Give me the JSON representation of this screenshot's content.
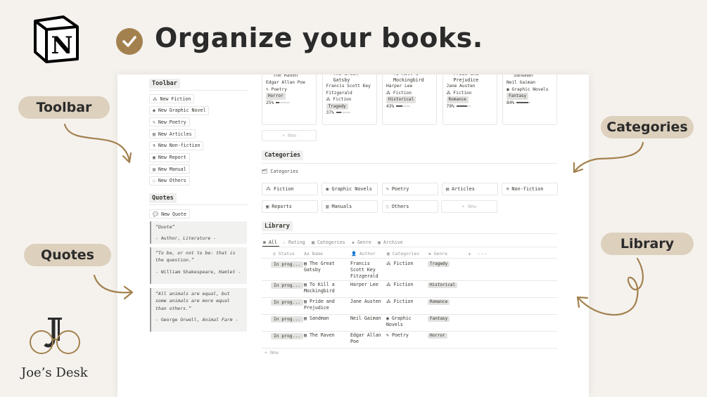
{
  "header": {
    "headline": "Organize your books."
  },
  "callouts": {
    "toolbar": "Toolbar",
    "quotes": "Quotes",
    "categories": "Categories",
    "library": "Library"
  },
  "brand": {
    "name": "Joe’s Desk"
  },
  "colors": {
    "accent": "#a3814e",
    "pill": "#ddd0bd",
    "background": "#f5f2ee"
  },
  "toolbar": {
    "title": "Toolbar",
    "buttons": [
      {
        "icon": "fiction-icon",
        "label": "New Fiction"
      },
      {
        "icon": "graphic-novel-icon",
        "label": "New Graphic Novel"
      },
      {
        "icon": "feather-icon",
        "label": "New Poetry"
      },
      {
        "icon": "articles-icon",
        "label": "New Articles"
      },
      {
        "icon": "flask-icon",
        "label": "New Non-fiction"
      },
      {
        "icon": "report-icon",
        "label": "New Report"
      },
      {
        "icon": "manual-icon",
        "label": "New Manual"
      },
      {
        "icon": "chat-icon",
        "label": "New Others"
      }
    ]
  },
  "quotes": {
    "title": "Quotes",
    "new_label": "New Quote",
    "items": [
      {
        "text": "“Quote”",
        "author": "- Author, ",
        "work": "Literature",
        "end": " -"
      },
      {
        "text": "“To be, or not to be: that is the question.”",
        "author": "- William Shakespeare, ",
        "work": "Hamlet",
        "end": " -"
      },
      {
        "text": "“All animals are equal, but some animals are more equal than others.”",
        "author": "- George Orwell, ",
        "work": "Animal Farm",
        "end": " -"
      }
    ]
  },
  "gallery": {
    "cards": [
      {
        "title": "The Raven",
        "author": "Edgar Allan Poe",
        "category": "Poetry",
        "genre": "Horror",
        "progress": "25%",
        "progress_value": 25
      },
      {
        "title": "The Great Gatsby",
        "author": "Francis Scott Key Fitzgerald",
        "category": "Fiction",
        "genre": "Tragedy",
        "progress": "37%",
        "progress_value": 37
      },
      {
        "title": "To Kill a Mockingbird",
        "author": "Harper Lee",
        "category": "Fiction",
        "genre": "Historical",
        "progress": "43%",
        "progress_value": 43
      },
      {
        "title": "Pride and Prejudice",
        "author": "Jane Austen",
        "category": "Fiction",
        "genre": "Romance",
        "progress": "79%",
        "progress_value": 79
      },
      {
        "title": "Sandman",
        "author": "Neil Gaiman",
        "category": "Graphic Novels",
        "genre": "Fantasy",
        "progress": "84%",
        "progress_value": 84
      }
    ],
    "new_label": "+ New"
  },
  "categories": {
    "title": "Categories",
    "db_label": "Categories",
    "items": [
      {
        "icon": "fiction-icon",
        "label": "Fiction"
      },
      {
        "icon": "graphic-novel-icon",
        "label": "Graphic Novels"
      },
      {
        "icon": "feather-icon",
        "label": "Poetry"
      },
      {
        "icon": "articles-icon",
        "label": "Articles"
      },
      {
        "icon": "flask-icon",
        "label": "Non-fiction"
      },
      {
        "icon": "report-icon",
        "label": "Reports"
      },
      {
        "icon": "manual-icon",
        "label": "Manuals"
      },
      {
        "icon": "chat-icon",
        "label": "Others"
      }
    ],
    "new_label": "+ New"
  },
  "library": {
    "title": "Library",
    "tabs": [
      "All",
      "Rating",
      "Categories",
      "Genre",
      "Archive"
    ],
    "columns": [
      "Status",
      "Name",
      "Author",
      "Categories",
      "Genre"
    ],
    "rows": [
      {
        "status": "In prog...",
        "name": "The Great Gatsby",
        "author": "Francis Scott Key Fitzgerald",
        "category": "Fiction",
        "genre": "Tragedy"
      },
      {
        "status": "In prog...",
        "name": "To Kill a Mockingbird",
        "author": "Harper Lee",
        "category": "Fiction",
        "genre": "Historical"
      },
      {
        "status": "In prog...",
        "name": "Pride and Prejudice",
        "author": "Jane Austen",
        "category": "Fiction",
        "genre": "Romance"
      },
      {
        "status": "In prog...",
        "name": "Sandman",
        "author": "Neil Gaiman",
        "category": "Graphic Novels",
        "genre": "Fantasy"
      },
      {
        "status": "In prog...",
        "name": "The Raven",
        "author": "Edgar Allan Poe",
        "category": "Poetry",
        "genre": "Horror"
      }
    ],
    "new_label": "+ New"
  }
}
